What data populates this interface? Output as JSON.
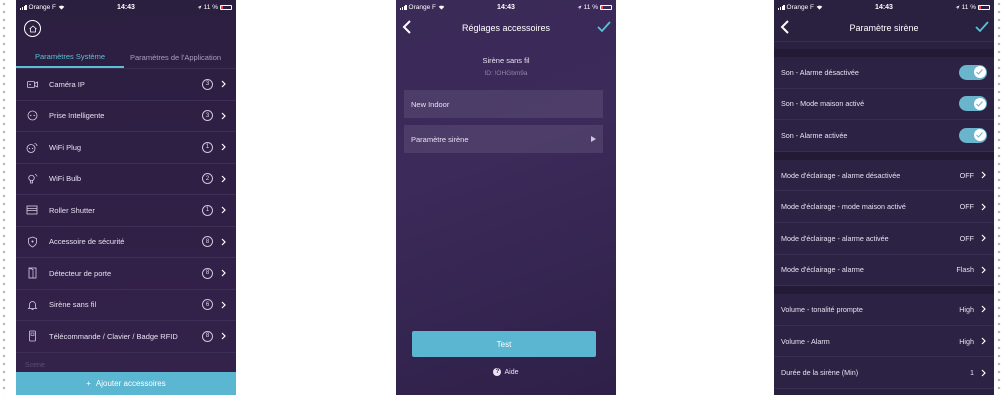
{
  "colors": {
    "accent": "#5bb6d2",
    "tab_active": "#5bc0d6",
    "toggle_on": "#6ab4cc",
    "battery_low": "#e94b4b"
  },
  "status_bar": {
    "carrier": "Orange F",
    "time": "14:43",
    "battery": "11 %"
  },
  "screen1": {
    "tabs": [
      {
        "label": "Paramètres Système",
        "active": true
      },
      {
        "label": "Paramètres de l'Application",
        "active": false
      }
    ],
    "devices": [
      {
        "label": "Caméra IP",
        "count": "3",
        "icon": "camera-icon"
      },
      {
        "label": "Prise Intelligente",
        "count": "3",
        "icon": "smart-plug-icon"
      },
      {
        "label": "WiFi Plug",
        "count": "1",
        "icon": "wifi-plug-icon"
      },
      {
        "label": "WiFi Bulb",
        "count": "2",
        "icon": "bulb-icon"
      },
      {
        "label": "Roller Shutter",
        "count": "1",
        "icon": "shutter-icon"
      },
      {
        "label": "Accessoire de sécurité",
        "count": "8",
        "icon": "shield-icon"
      },
      {
        "label": "Détecteur de porte",
        "count": "8",
        "icon": "door-icon"
      },
      {
        "label": "Sirène sans fil",
        "count": "6",
        "icon": "bell-icon"
      },
      {
        "label": "Télécommande / Clavier / Badge RFID",
        "count": "8",
        "icon": "remote-icon"
      }
    ],
    "scene_label": "Scene",
    "add_button": "Ajouter accessoires"
  },
  "screen2": {
    "title": "Réglages accessoires",
    "device_name": "Sirène sans fil",
    "device_id": "ID: !OHGbm9a",
    "name_field": "New Indoor",
    "siren_settings": "Paramètre sirène",
    "test_button": "Test",
    "help": "Aide"
  },
  "screen3": {
    "title": "Paramètre sirène",
    "groups": [
      [
        {
          "label": "Son - Alarme désactivée",
          "toggle": true
        },
        {
          "label": "Son - Mode maison activé",
          "toggle": true
        },
        {
          "label": "Son - Alarme activée",
          "toggle": true
        }
      ],
      [
        {
          "label": "Mode d'éclairage - alarme désactivée",
          "value": "OFF"
        },
        {
          "label": "Mode d'éclairage - mode maison activé",
          "value": "OFF"
        },
        {
          "label": "Mode d'éclairage - alarme activée",
          "value": "OFF"
        },
        {
          "label": "Mode d'éclairage - alarme",
          "value": "Flash"
        }
      ],
      [
        {
          "label": "Volume - tonalité prompte",
          "value": "High"
        },
        {
          "label": "Volume - Alarm",
          "value": "High"
        },
        {
          "label": "Durée de la sirène (Min)",
          "value": "1"
        }
      ]
    ]
  }
}
